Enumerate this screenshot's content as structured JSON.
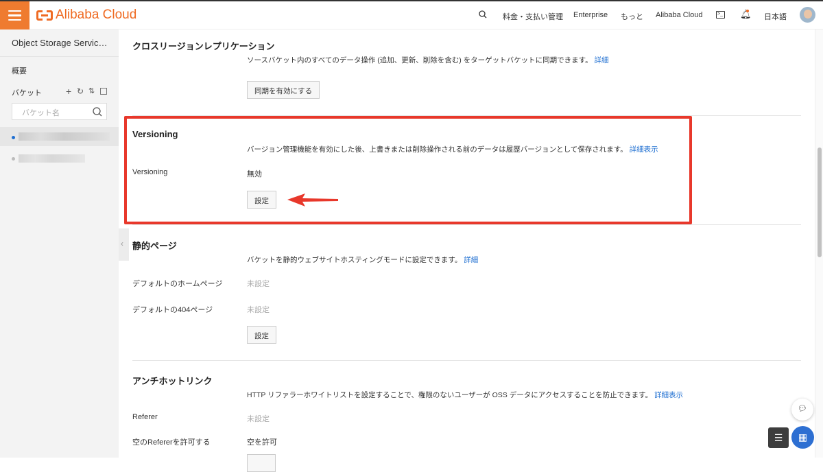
{
  "header": {
    "brand": "Alibaba Cloud",
    "nav": [
      "料金・支払い管理",
      "Enterprise",
      "もっと",
      "Alibaba Cloud"
    ],
    "language": "日本語",
    "notification_dot_color": "#ef6b23",
    "brand_color": "#ef6b23"
  },
  "sidebar": {
    "title": "Object Storage Servic…",
    "overview": "概要",
    "buckets_label": "バケット",
    "search_placeholder": "バケット名"
  },
  "sections": {
    "crr": {
      "title": "クロスリージョンレプリケーション",
      "desc": "ソースバケット内のすべてのデータ操作 (追加、更新、削除を含む) をターゲットバケットに同期できます。",
      "link": "詳細",
      "button": "同期を有効にする"
    },
    "versioning": {
      "title": "Versioning",
      "desc": "バージョン管理機能を有効にした後、上書きまたは削除操作される前のデータは履歴バージョンとして保存されます。",
      "link": "詳細表示",
      "label": "Versioning",
      "value": "無効",
      "button": "設定"
    },
    "static": {
      "title": "静的ページ",
      "desc": "バケットを静的ウェブサイトホスティングモードに設定できます。",
      "link": "詳細",
      "home_label": "デフォルトのホームページ",
      "home_value": "未設定",
      "404_label": "デフォルトの404ページ",
      "404_value": "未設定",
      "button": "設定"
    },
    "hotlink": {
      "title": "アンチホットリンク",
      "desc": "HTTP リファラーホワイトリストを設定することで、権限のないユーザーが OSS データにアクセスすることを防止できます。",
      "link": "詳細表示",
      "referer_label": "Referer",
      "referer_value": "未設定",
      "empty_label": "空のRefererを許可する",
      "empty_value": "空を許可"
    }
  },
  "annotation": {
    "highlight_color": "#e8382b"
  }
}
